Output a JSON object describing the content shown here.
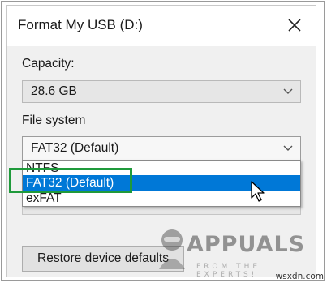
{
  "window": {
    "title": "Format My USB (D:)",
    "close_icon": "close-icon"
  },
  "capacity": {
    "label": "Capacity:",
    "value": "28.6 GB"
  },
  "file_system": {
    "label": "File system",
    "selected": "FAT32 (Default)",
    "options": [
      "NTFS",
      "FAT32 (Default)",
      "exFAT"
    ],
    "highlighted_option": "FAT32 (Default)"
  },
  "buttons": {
    "restore_defaults": "Restore device defaults"
  },
  "watermark": {
    "brand": "APPUALS",
    "tagline": "FROM THE EXPERTS!",
    "site": "wsxdn.com"
  },
  "colors": {
    "selection": "#0078d7",
    "highlight_box": "#1f9a3b"
  }
}
